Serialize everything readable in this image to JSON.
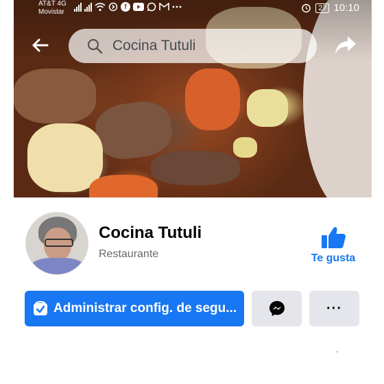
{
  "statusbar": {
    "carrier_line1": "AT&T 4G",
    "carrier_line2": "Movistar",
    "battery": "27",
    "time": "10:10",
    "icons": [
      "signal-icon",
      "signal-icon",
      "wifi-icon",
      "sync-icon",
      "facebook-icon",
      "youtube-icon",
      "whatsapp-icon",
      "gmail-icon",
      "more-icon",
      "alarm-icon",
      "battery-icon"
    ]
  },
  "header": {
    "search_text": "Cocina Tutuli"
  },
  "profile": {
    "name": "Cocina Tutuli",
    "category": "Restaurante"
  },
  "like": {
    "label": "Te gusta"
  },
  "actions": {
    "primary_label": "Administrar config. de segu...",
    "more_label": "···"
  },
  "colors": {
    "accent": "#1877f2",
    "button_gray": "#e4e6eb",
    "text_primary": "#050505",
    "text_secondary": "#65676b"
  }
}
